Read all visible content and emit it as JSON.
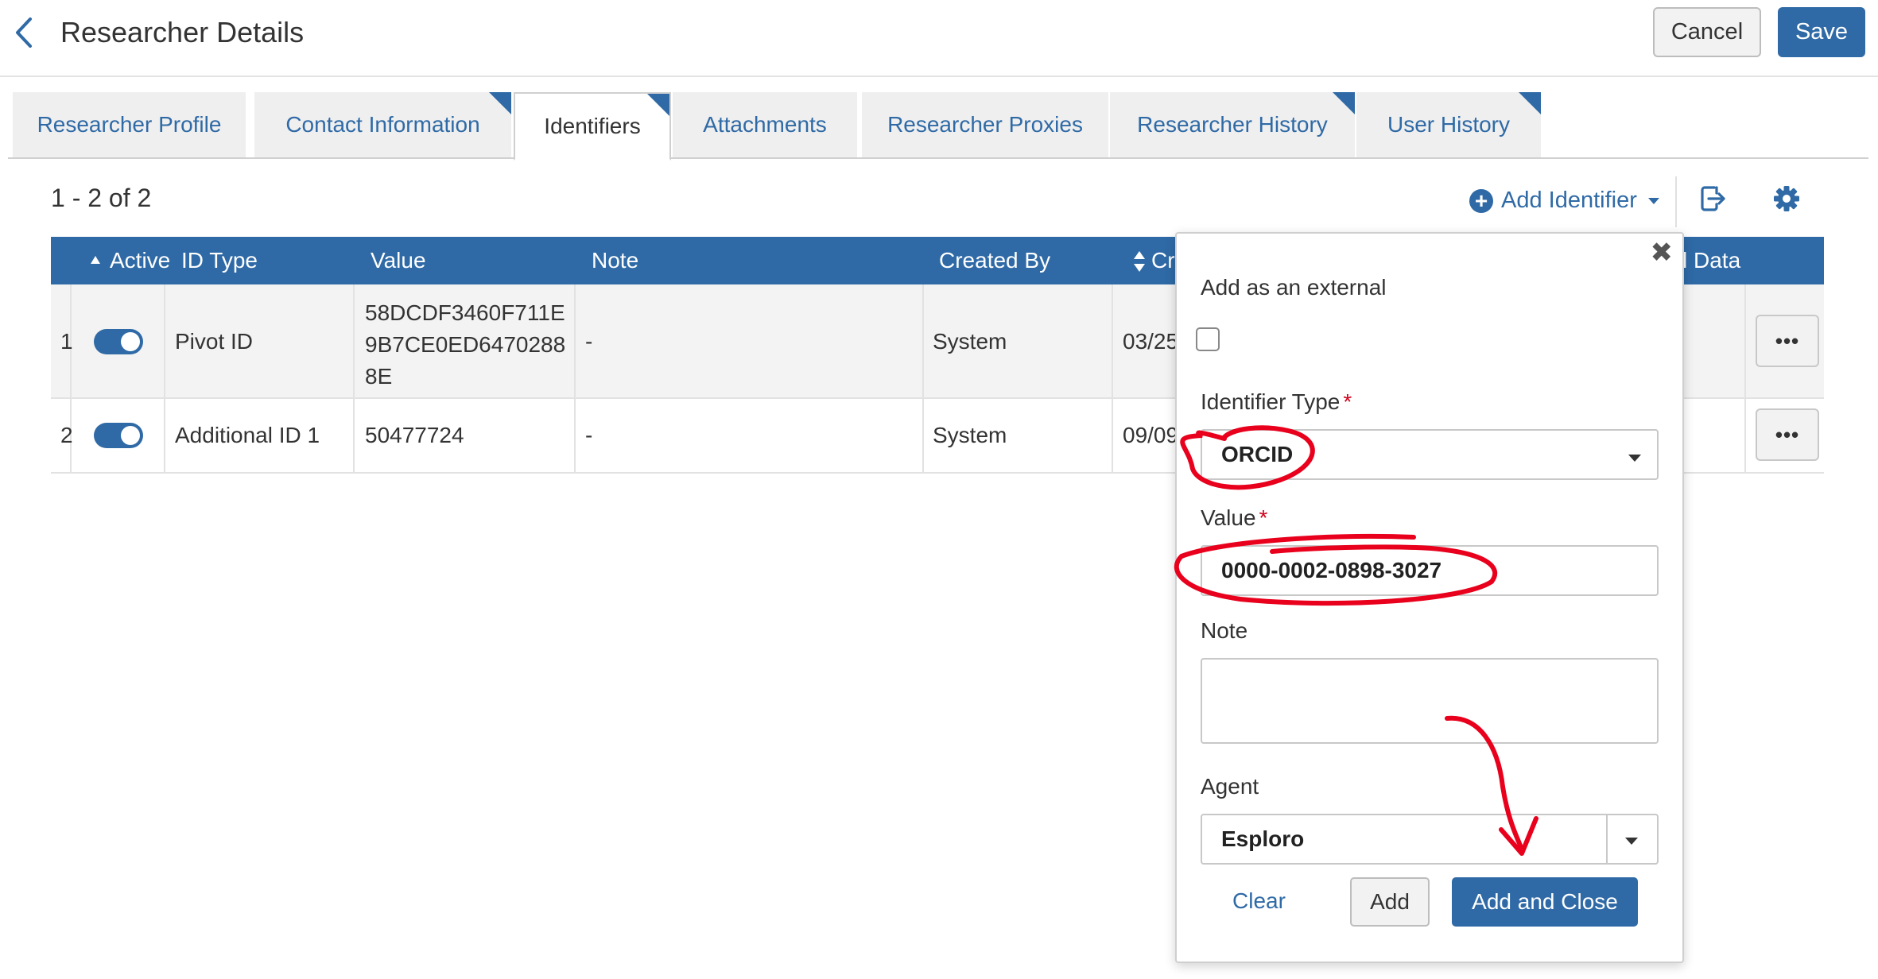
{
  "header": {
    "title": "Researcher Details",
    "cancel_label": "Cancel",
    "save_label": "Save"
  },
  "tabs": [
    {
      "label": "Researcher Profile",
      "active": false,
      "has_corner": false
    },
    {
      "label": "Contact Information",
      "active": false,
      "has_corner": true
    },
    {
      "label": "Identifiers",
      "active": true,
      "has_corner": true
    },
    {
      "label": "Attachments",
      "active": false,
      "has_corner": false
    },
    {
      "label": "Researcher Proxies",
      "active": false,
      "has_corner": false
    },
    {
      "label": "Researcher History",
      "active": false,
      "has_corner": true
    },
    {
      "label": "User History",
      "active": false,
      "has_corner": true
    }
  ],
  "toolbar": {
    "count": "1 - 2 of 2",
    "add_identifier_label": "Add Identifier"
  },
  "table": {
    "columns": {
      "active": "Active",
      "id_type": "ID Type",
      "value": "Value",
      "note": "Note",
      "created_by": "Created By",
      "created": "Cr",
      "data": "l Data"
    },
    "rows": [
      {
        "num": "1",
        "active": true,
        "id_type": "Pivot ID",
        "value_lines": [
          "58DCDF3460F711E",
          "9B7CE0ED6470288",
          "8E"
        ],
        "note": "-",
        "created_by": "System",
        "created": "03/25",
        "more": "•••"
      },
      {
        "num": "2",
        "active": true,
        "id_type": "Additional ID 1",
        "value_lines": [
          "50477724"
        ],
        "note": "-",
        "created_by": "System",
        "created": "09/09",
        "more": "•••"
      }
    ]
  },
  "popup": {
    "close": "✖",
    "external_label": "Add as an external",
    "identifier_type_label": "Identifier Type",
    "identifier_type_value": "ORCID",
    "value_label": "Value",
    "value_value": "0000-0002-0898-3027",
    "note_label": "Note",
    "note_value": "",
    "agent_label": "Agent",
    "agent_value": "Esploro",
    "required_mark": "*",
    "clear_label": "Clear",
    "add_label": "Add",
    "add_close_label": "Add and Close"
  },
  "colors": {
    "primary": "#2f6aa6",
    "annotation": "#e8001c"
  }
}
